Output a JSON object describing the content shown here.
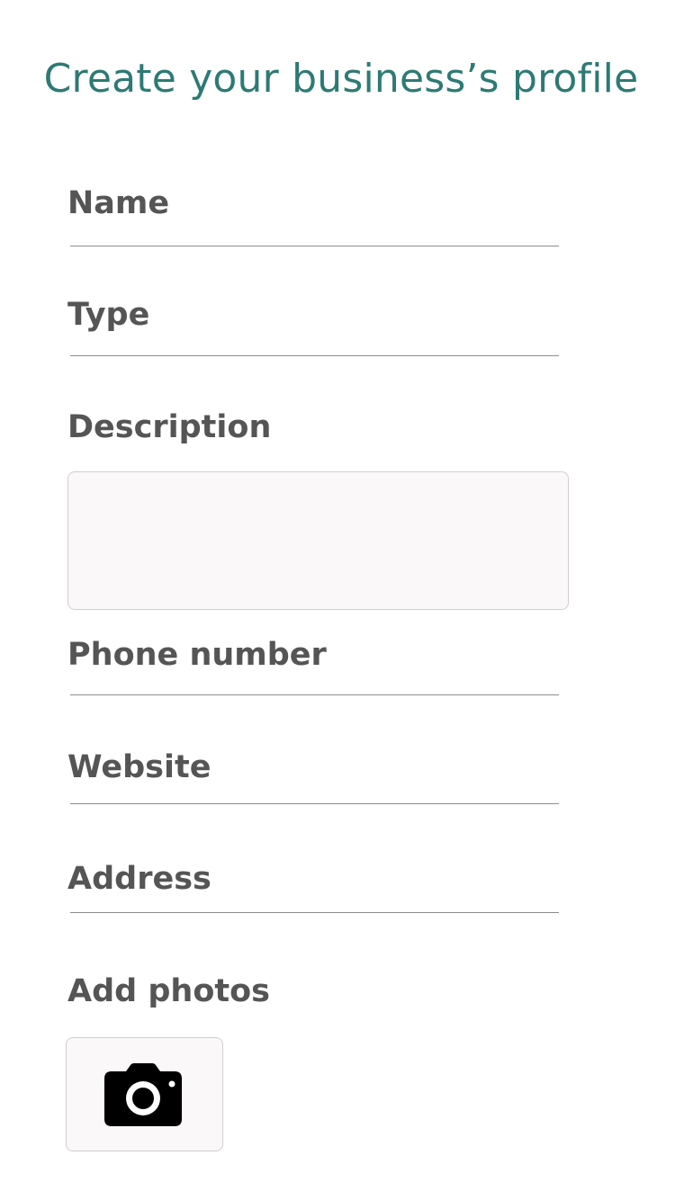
{
  "header": {
    "title": "Create your business’s profile"
  },
  "form": {
    "name": {
      "label": "Name",
      "value": ""
    },
    "type": {
      "label": "Type",
      "value": ""
    },
    "description": {
      "label": "Description",
      "value": ""
    },
    "phone": {
      "label": "Phone number",
      "value": ""
    },
    "website": {
      "label": "Website",
      "value": ""
    },
    "address": {
      "label": "Address",
      "value": ""
    },
    "photos": {
      "label": "Add photos",
      "icon": "camera-icon"
    }
  },
  "colors": {
    "accent": "#2d7a74",
    "label": "#555555",
    "underline": "#8c8c8c",
    "field_background": "#faf8f9"
  }
}
